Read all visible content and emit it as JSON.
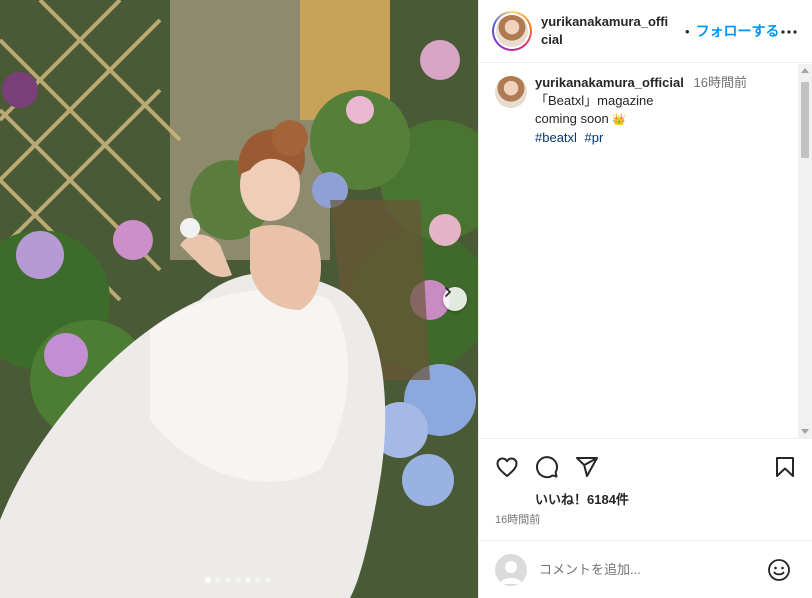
{
  "post": {
    "username": "yurikanakamura_official",
    "header_username_line1": "yurikanakamura_offi",
    "header_username_line2": "cial",
    "follow_label": "フォローする",
    "separator": "•",
    "caption": {
      "username": "yurikanakamura_official",
      "time": "16時間前",
      "line1": "「Beatxl」magazine",
      "line2": "coming soon",
      "crown": "👑",
      "hashtags": [
        "#beatxl",
        "#pr"
      ]
    },
    "likes_text": "いいね！6184件",
    "posted_time": "16時間前",
    "comment_placeholder": "コメントを追加...",
    "carousel": {
      "total": 7,
      "active_index": 0
    }
  },
  "icons": {
    "more": "more-options-icon",
    "like": "heart-icon",
    "comment": "comment-icon",
    "share": "share-icon",
    "save": "bookmark-icon",
    "next": "chevron-right-icon",
    "emoji": "smiley-icon"
  },
  "colors": {
    "follow_blue": "#0095f6",
    "hashtag": "#00376b",
    "text": "#262626",
    "muted": "#737373",
    "border": "#efefef"
  }
}
